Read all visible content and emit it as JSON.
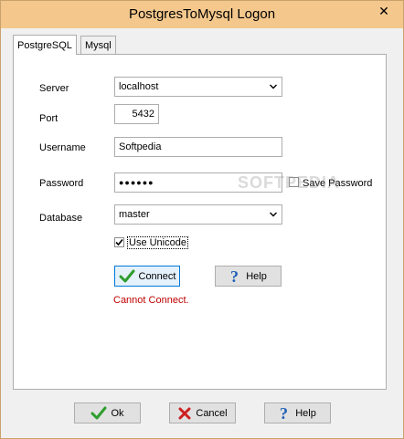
{
  "window": {
    "title": "PostgresToMysql Logon",
    "close_glyph": "✕"
  },
  "tabs": [
    {
      "label": "PostgreSQL",
      "active": true
    },
    {
      "label": "Mysql",
      "active": false
    }
  ],
  "form": {
    "server_label": "Server",
    "server_value": "localhost",
    "port_label": "Port",
    "port_value": "5432",
    "username_label": "Username",
    "username_value": "Softpedia",
    "password_label": "Password",
    "password_value": "●●●●●●",
    "save_password_label": "Save Password",
    "save_password_checked": false,
    "database_label": "Database",
    "database_value": "master",
    "use_unicode_label": "Use Unicode",
    "use_unicode_checked": true,
    "connect_label": "Connect",
    "help_label": "Help",
    "status_text": "Cannot Connect."
  },
  "footer": {
    "ok_label": "Ok",
    "cancel_label": "Cancel",
    "help_label": "Help"
  },
  "watermark": "SOFTPEDIA",
  "colors": {
    "titlebar": "#f4c88d",
    "error": "#c00000",
    "ok_check": "#2e9e2e",
    "cancel_x": "#cc2020",
    "help_icon": "#1d5fb5"
  }
}
